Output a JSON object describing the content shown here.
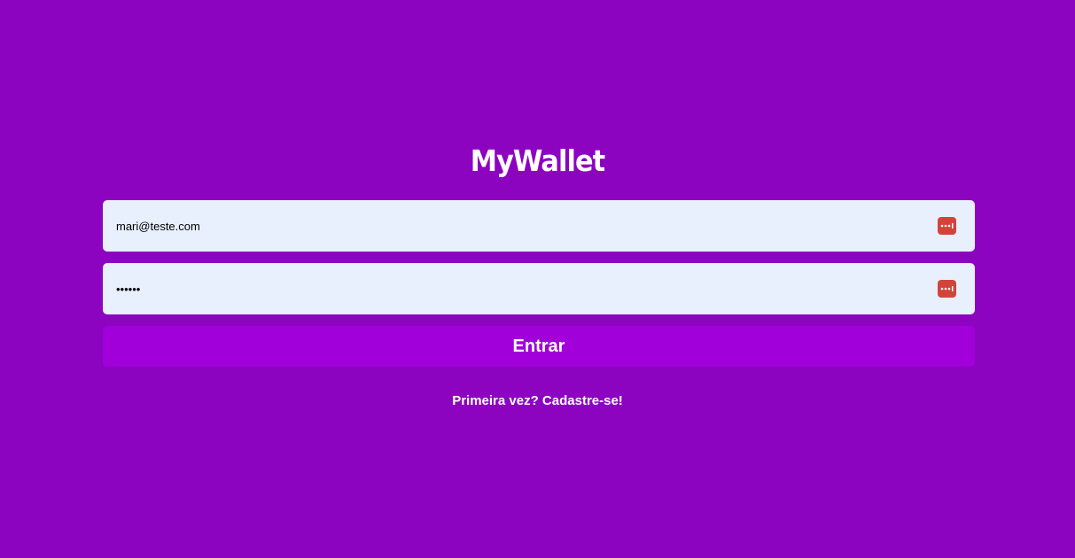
{
  "app": {
    "logo": "MyWallet"
  },
  "login_form": {
    "email": {
      "value": "mari@teste.com",
      "icon": "password-manager-icon"
    },
    "password": {
      "value": "••••••",
      "icon": "password-manager-icon"
    },
    "submit_label": "Entrar",
    "signup_link": "Primeira vez? Cadastre-se!"
  },
  "colors": {
    "background": "#8C03C0",
    "button": "#A100DB",
    "input_bg": "#E8F0FE",
    "icon_bg": "#D2443A",
    "text": "#FFFFFF"
  }
}
